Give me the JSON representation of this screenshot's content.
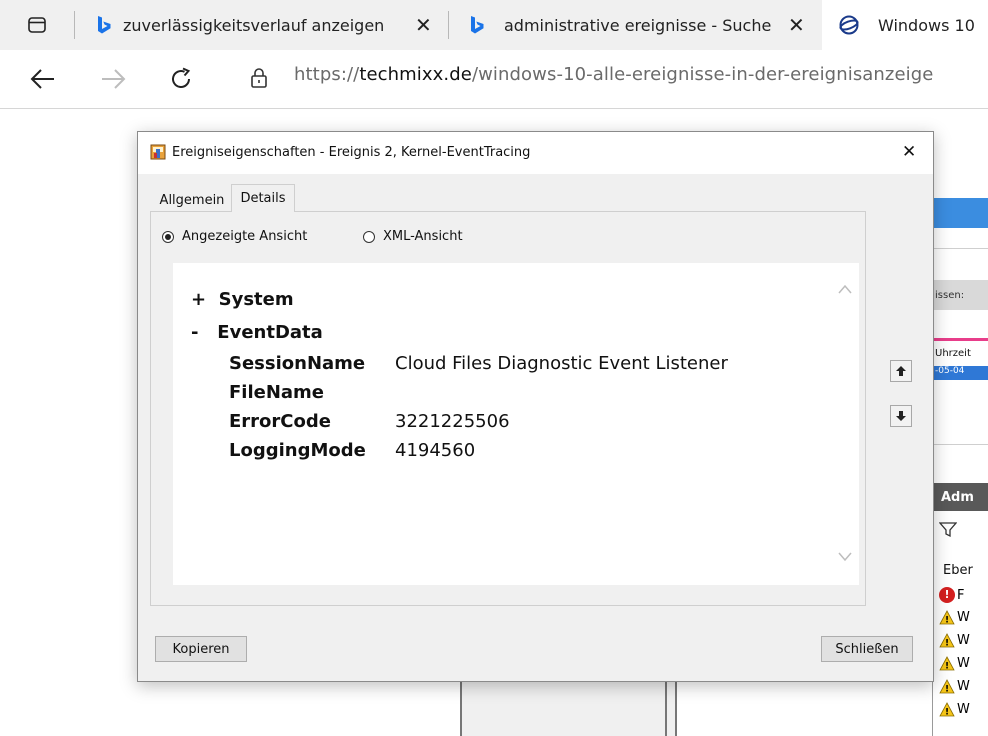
{
  "browser": {
    "tabs": [
      {
        "label": "zuverlässigkeitsverlauf anzeigen"
      },
      {
        "label": "administrative ereignisse - Suche"
      },
      {
        "label": "Windows 10"
      }
    ],
    "url_scheme": "https://",
    "url_domain": "techmixx.de",
    "url_path": "/windows-10-alle-ereignisse-in-der-ereignisanzeige"
  },
  "background": {
    "side_label1": "issen:",
    "side_label2": "Uhrzeit",
    "side_label3": "-05-04",
    "side_header": "Adm",
    "side_list_header": "Eber",
    "side_items": [
      "F",
      "W",
      "W",
      "W",
      "W",
      "W"
    ]
  },
  "dialog": {
    "title": "Ereigniseigenschaften - Ereignis 2, Kernel-EventTracing",
    "tabs": [
      "Allgemein",
      "Details"
    ],
    "radio_friendly": "Angezeigte Ansicht",
    "radio_xml": "XML-Ansicht",
    "tree": {
      "system": {
        "sign": "+",
        "label": "System"
      },
      "eventdata": {
        "sign": "-",
        "label": "EventData"
      },
      "fields": [
        {
          "key": "SessionName",
          "value": "Cloud Files Diagnostic Event Listener"
        },
        {
          "key": "FileName",
          "value": ""
        },
        {
          "key": "ErrorCode",
          "value": "3221225506"
        },
        {
          "key": "LoggingMode",
          "value": "4194560"
        }
      ]
    },
    "copy_button": "Kopieren",
    "close_button": "Schließen"
  }
}
